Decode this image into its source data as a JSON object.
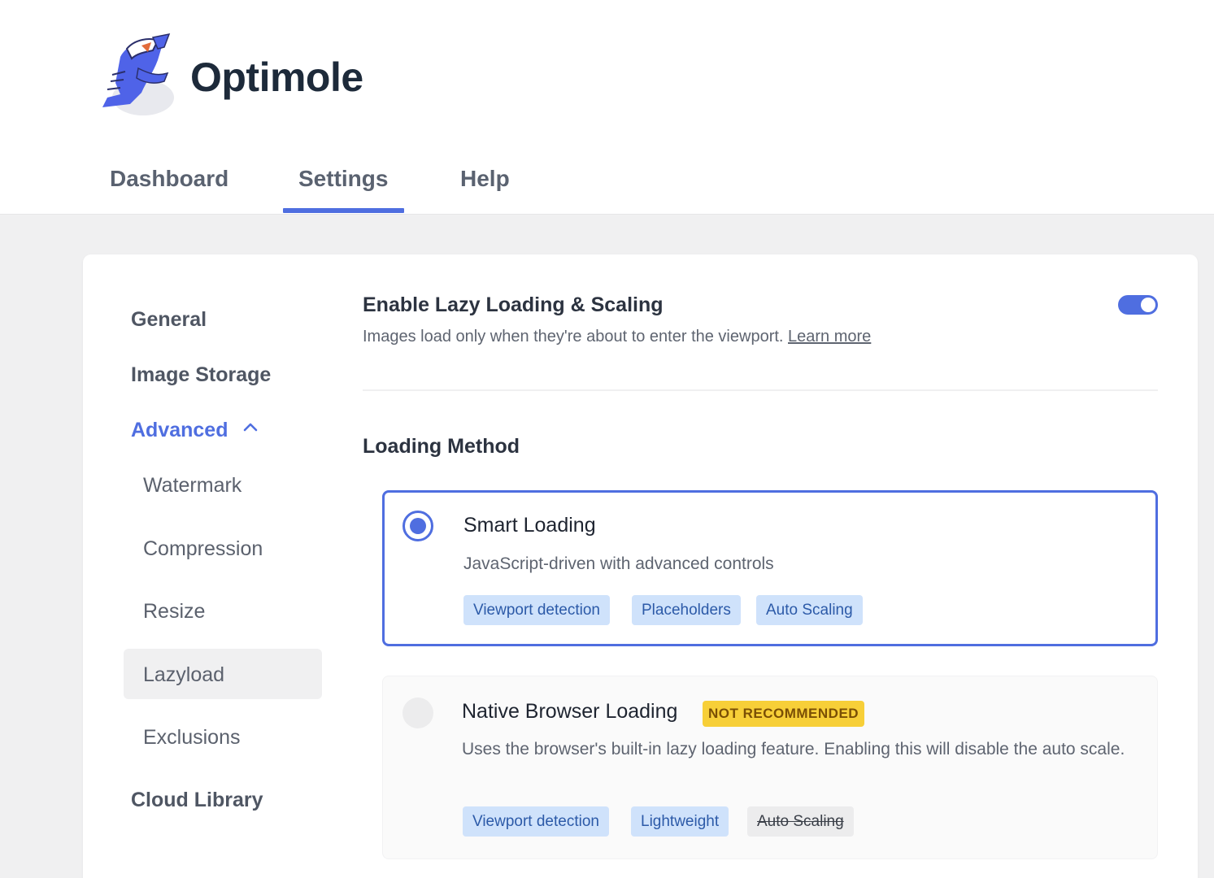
{
  "app": {
    "brand_name": "Optimole",
    "accent_color": "#4f6ee0"
  },
  "tabs": [
    {
      "label": "Dashboard",
      "active": false
    },
    {
      "label": "Settings",
      "active": true
    },
    {
      "label": "Help",
      "active": false
    }
  ],
  "sidebar": {
    "general": "General",
    "image_storage": "Image Storage",
    "advanced": {
      "label": "Advanced",
      "expanded": true,
      "icon": "chevron-up-icon"
    },
    "sub_items": [
      "Watermark",
      "Compression",
      "Resize",
      "Lazyload",
      "Exclusions"
    ],
    "active_item": "Lazyload",
    "cloud_library": "Cloud Library"
  },
  "lazy": {
    "title": "Enable Lazy Loading & Scaling",
    "description": "Images load only when they're about to enter the viewport.",
    "learn_more": "Learn more",
    "enabled": true
  },
  "loading_method": {
    "title": "Loading Method",
    "options": [
      {
        "title": "Smart Loading",
        "description": "JavaScript-driven with advanced controls",
        "selected": true,
        "chips": [
          "Viewport detection",
          "Placeholders",
          "Auto Scaling"
        ]
      },
      {
        "title": "Native Browser Loading",
        "badge": "NOT RECOMMENDED",
        "description": "Uses the browser's built-in lazy loading feature. Enabling this will disable the auto scale.",
        "selected": false,
        "chips": [
          "Viewport detection",
          "Lightweight"
        ],
        "disabled_chip": "Auto Scaling"
      }
    ]
  }
}
